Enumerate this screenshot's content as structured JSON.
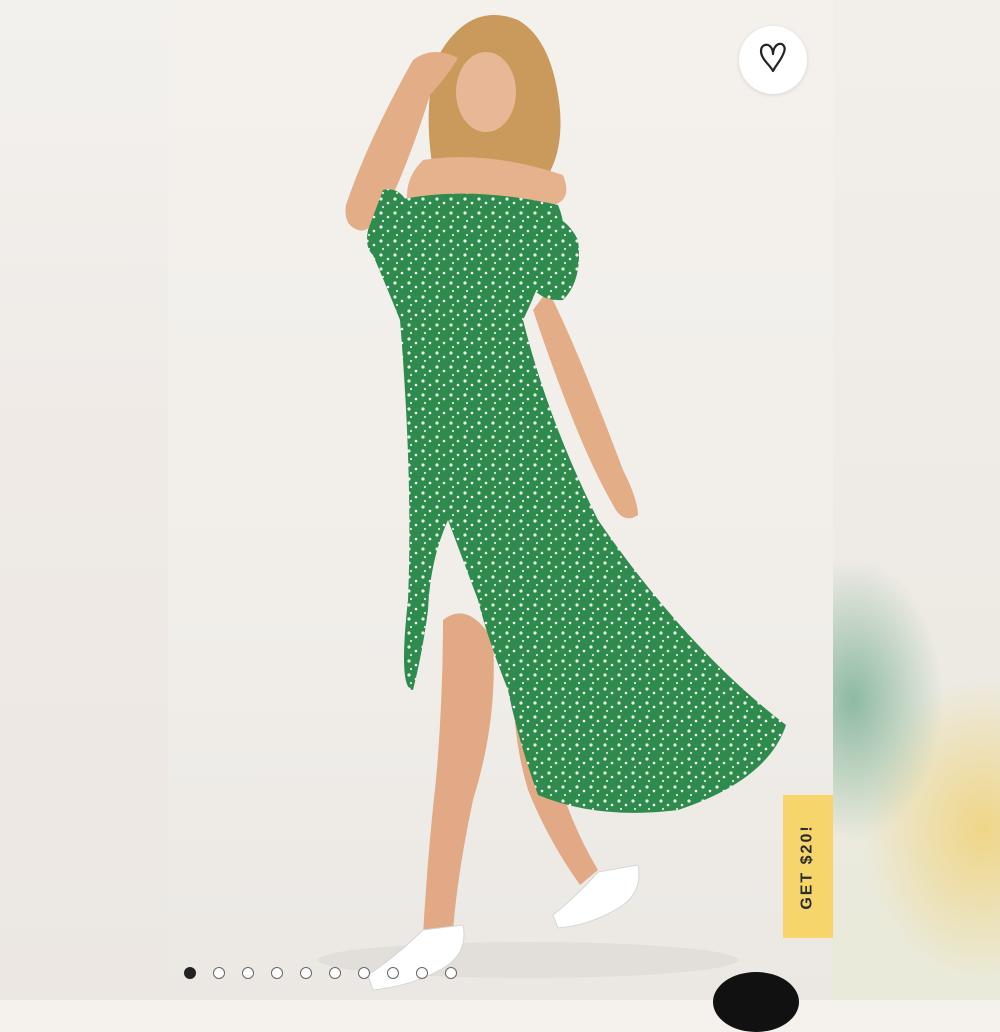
{
  "product_gallery": {
    "image_alt": "",
    "total_images": 10,
    "active_index": 0
  },
  "wishlist": {
    "icon": "heart-icon"
  },
  "promo": {
    "label": "GET $20!"
  },
  "colors": {
    "dress": "#2f8a4e",
    "promo_bg": "#f6d56a",
    "dot_active": "#222222"
  }
}
